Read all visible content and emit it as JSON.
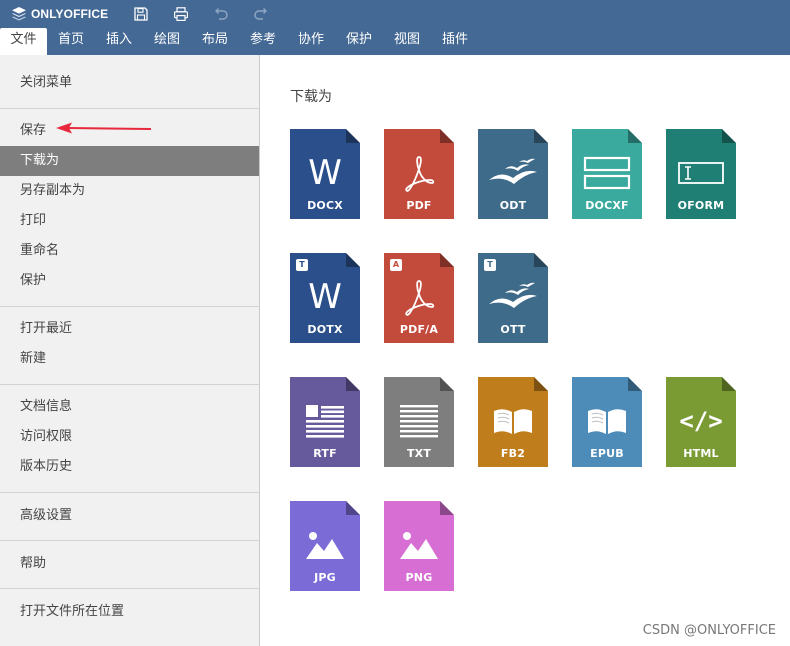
{
  "app": {
    "name": "ONLYOFFICE"
  },
  "tabs": [
    {
      "label": "文件"
    },
    {
      "label": "首页"
    },
    {
      "label": "插入"
    },
    {
      "label": "绘图"
    },
    {
      "label": "布局"
    },
    {
      "label": "参考"
    },
    {
      "label": "协作"
    },
    {
      "label": "保护"
    },
    {
      "label": "视图"
    },
    {
      "label": "插件"
    }
  ],
  "active_tab": "文件",
  "menu": [
    {
      "label": "关闭菜单"
    },
    {
      "label": "保存"
    },
    {
      "label": "下载为"
    },
    {
      "label": "另存副本为"
    },
    {
      "label": "打印"
    },
    {
      "label": "重命名"
    },
    {
      "label": "保护"
    },
    {
      "label": "打开最近"
    },
    {
      "label": "新建"
    },
    {
      "label": "文档信息"
    },
    {
      "label": "访问权限"
    },
    {
      "label": "版本历史"
    },
    {
      "label": "高级设置"
    },
    {
      "label": "帮助"
    },
    {
      "label": "打开文件所在位置"
    }
  ],
  "selected_menu": "下载为",
  "content": {
    "title": "下载为"
  },
  "formats": [
    {
      "label": "DOCX",
      "color": "#2b4f8a",
      "icon": "word-icon"
    },
    {
      "label": "PDF",
      "color": "#c24b3b",
      "icon": "pdf-icon"
    },
    {
      "label": "ODT",
      "color": "#3f6b8a",
      "icon": "gulls-icon"
    },
    {
      "label": "DOCXF",
      "color": "#3aaa9e",
      "icon": "form-fields-icon"
    },
    {
      "label": "OFORM",
      "color": "#1f7f75",
      "icon": "text-field-icon"
    },
    {
      "label": "DOTX",
      "color": "#2b4f8a",
      "icon": "word-icon",
      "badge": "T"
    },
    {
      "label": "PDF/A",
      "color": "#c24b3b",
      "icon": "pdf-icon",
      "badge": "A"
    },
    {
      "label": "OTT",
      "color": "#3f6b8a",
      "icon": "gulls-icon",
      "badge": "T"
    },
    {
      "label": "RTF",
      "color": "#665a9c",
      "icon": "rich-text-icon"
    },
    {
      "label": "TXT",
      "color": "#7e7e7e",
      "icon": "plain-text-icon"
    },
    {
      "label": "FB2",
      "color": "#c07d1b",
      "icon": "book-icon"
    },
    {
      "label": "EPUB",
      "color": "#4d8cb8",
      "icon": "book-icon"
    },
    {
      "label": "HTML",
      "color": "#7a9a33",
      "icon": "code-icon",
      "glyph": "</>"
    },
    {
      "label": "JPG",
      "color": "#7b6bd6",
      "icon": "image-icon"
    },
    {
      "label": "PNG",
      "color": "#d66ed3",
      "icon": "image-icon"
    }
  ],
  "watermark": "CSDN @ONLYOFFICE"
}
